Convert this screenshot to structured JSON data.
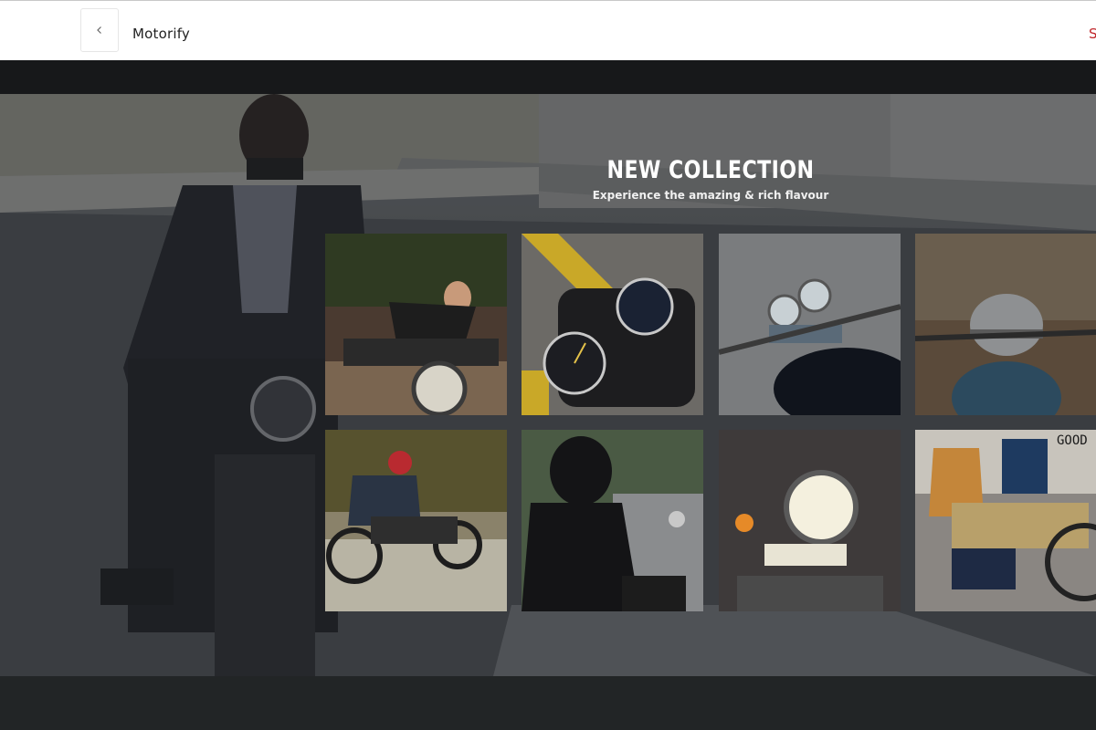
{
  "header": {
    "back_icon": "chevron-left-icon",
    "brand": "Motorify",
    "right_link": "S"
  },
  "hero": {
    "title": "NEW COLLECTION",
    "subtitle": "Experience the amazing & rich flavour"
  },
  "gallery": {
    "photos": [
      "rider-leaning-on-motorcycle-photo",
      "speedometer-gauges-photo",
      "handlebar-gauges-photo",
      "helmet-on-motorcycle-photo",
      "two-riders-on-motorcycle-photo",
      "rider-in-helmet-photo",
      "motorcycle-headlight-photo",
      "rider-on-cafe-racer-photo"
    ],
    "last_tile_sign": "GOOD"
  },
  "colors": {
    "accent": "#c0262b",
    "header_bg": "#ffffff",
    "dark_strip": "#17181a",
    "footer_bg": "#222526"
  }
}
